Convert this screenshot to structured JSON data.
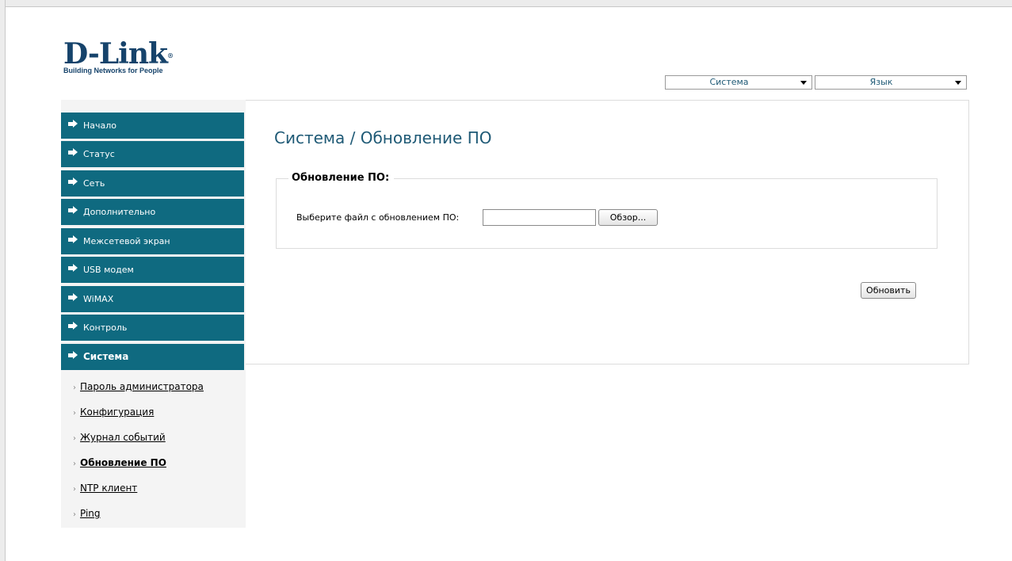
{
  "brand": {
    "name": "D-Link",
    "reg_mark": "®",
    "tagline": "Building Networks for People"
  },
  "header": {
    "system_select": {
      "value": "Система"
    },
    "language_select": {
      "value": "Язык"
    }
  },
  "sidebar": {
    "menu": [
      {
        "label": "Начало"
      },
      {
        "label": "Статус"
      },
      {
        "label": "Сеть"
      },
      {
        "label": "Дополнительно"
      },
      {
        "label": "Межсетевой экран"
      },
      {
        "label": "USB модем"
      },
      {
        "label": "WiMAX"
      },
      {
        "label": "Контроль"
      },
      {
        "label": "Система",
        "active": true
      }
    ],
    "submenu": [
      {
        "label": "Пароль администратора"
      },
      {
        "label": "Конфигурация"
      },
      {
        "label": "Журнал событий"
      },
      {
        "label": "Обновление ПО",
        "active": true
      },
      {
        "label": "NTP клиент"
      },
      {
        "label": "Ping"
      }
    ],
    "submenu_bullet": "›"
  },
  "main": {
    "title": "Система / Обновление ПО",
    "section_title": "Обновление ПО:",
    "file_label": "Выберите файл с обновлением ПО:",
    "file_value": "",
    "browse_label": "Обзор...",
    "update_label": "Обновить"
  },
  "colors": {
    "menu_bg": "#0f6a80",
    "title": "#1f5a76",
    "logo": "#16436b"
  }
}
